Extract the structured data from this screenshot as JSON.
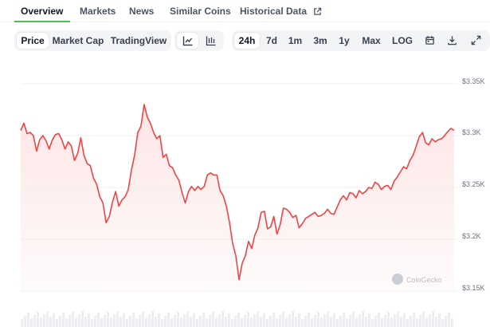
{
  "tabs": [
    {
      "label": "Overview",
      "active": true
    },
    {
      "label": "Markets"
    },
    {
      "label": "News"
    },
    {
      "label": "Similar Coins"
    },
    {
      "label": "Historical Data",
      "icon": "external-link-icon"
    }
  ],
  "toolbar": {
    "chart_types": [
      {
        "label": "Price",
        "active": true
      },
      {
        "label": "Market Cap"
      },
      {
        "label": "TradingView"
      }
    ],
    "view_icons": [
      "line-chart-icon",
      "candlestick-chart-icon"
    ],
    "ranges": [
      {
        "label": "24h",
        "active": true
      },
      {
        "label": "7d"
      },
      {
        "label": "1m"
      },
      {
        "label": "3m"
      },
      {
        "label": "1y"
      },
      {
        "label": "Max"
      },
      {
        "label": "LOG"
      }
    ],
    "action_icons": [
      "calendar-icon",
      "download-icon",
      "expand-icon"
    ]
  },
  "chart": {
    "y_ticks": [
      "$3.35K",
      "$3.3K",
      "$3.25K",
      "$3.2K",
      "$3.15K"
    ],
    "watermark": "CoinGecko",
    "line_color": "#ef4444",
    "fill_color": "#fde4e4"
  },
  "chart_data": {
    "type": "area",
    "ylim": [
      3150,
      3350
    ],
    "series": [
      {
        "values": [
          3305,
          3312,
          3302,
          3303,
          3300,
          3285,
          3296,
          3300,
          3295,
          3287,
          3296,
          3301,
          3302,
          3296,
          3287,
          3294,
          3290,
          3276,
          3283,
          3298,
          3281,
          3273,
          3271,
          3259,
          3253,
          3241,
          3235,
          3216,
          3222,
          3236,
          3246,
          3232,
          3238,
          3241,
          3248,
          3267,
          3281,
          3303,
          3309,
          3330,
          3318,
          3312,
          3303,
          3297,
          3300,
          3279,
          3282,
          3271,
          3269,
          3262,
          3257,
          3245,
          3235,
          3246,
          3251,
          3247,
          3251,
          3248,
          3251,
          3262,
          3264,
          3262,
          3262,
          3247,
          3242,
          3232,
          3216,
          3196,
          3184,
          3161,
          3177,
          3184,
          3198,
          3191,
          3204,
          3211,
          3226,
          3227,
          3210,
          3212,
          3222,
          3205,
          3214,
          3230,
          3229,
          3226,
          3221,
          3223,
          3211,
          3215,
          3220,
          3222,
          3224,
          3226,
          3222,
          3223,
          3225,
          3229,
          3225,
          3224,
          3231,
          3238,
          3242,
          3238,
          3245,
          3244,
          3240,
          3247,
          3244,
          3246,
          3250,
          3249,
          3255,
          3253,
          3248,
          3251,
          3252,
          3248,
          3256,
          3260,
          3265,
          3270,
          3268,
          3276,
          3281,
          3290,
          3299,
          3303,
          3293,
          3291,
          3297,
          3294,
          3296,
          3297,
          3300,
          3304,
          3307,
          3305
        ]
      }
    ]
  }
}
